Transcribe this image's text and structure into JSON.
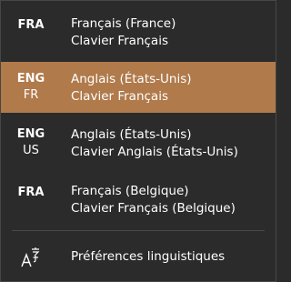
{
  "flyout": {
    "languages": [
      {
        "code": "FRA",
        "sub": "",
        "language": "Français (France)",
        "keyboard": "Clavier Français",
        "selected": false
      },
      {
        "code": "ENG",
        "sub": "FR",
        "language": "Anglais (États-Unis)",
        "keyboard": "Clavier Français",
        "selected": true
      },
      {
        "code": "ENG",
        "sub": "US",
        "language": "Anglais (États-Unis)",
        "keyboard": "Clavier Anglais (États-Unis)",
        "selected": false
      },
      {
        "code": "FRA",
        "sub": "",
        "language": "Français (Belgique)",
        "keyboard": "Clavier Français (Belgique)",
        "selected": false
      }
    ],
    "preferences_label": "Préférences linguistiques",
    "preferences_icon": "language-preferences-icon"
  },
  "colors": {
    "background": "#2b2b2b",
    "selected": "#b07a4b",
    "text": "#ffffff",
    "divider": "#4a4a4a"
  }
}
